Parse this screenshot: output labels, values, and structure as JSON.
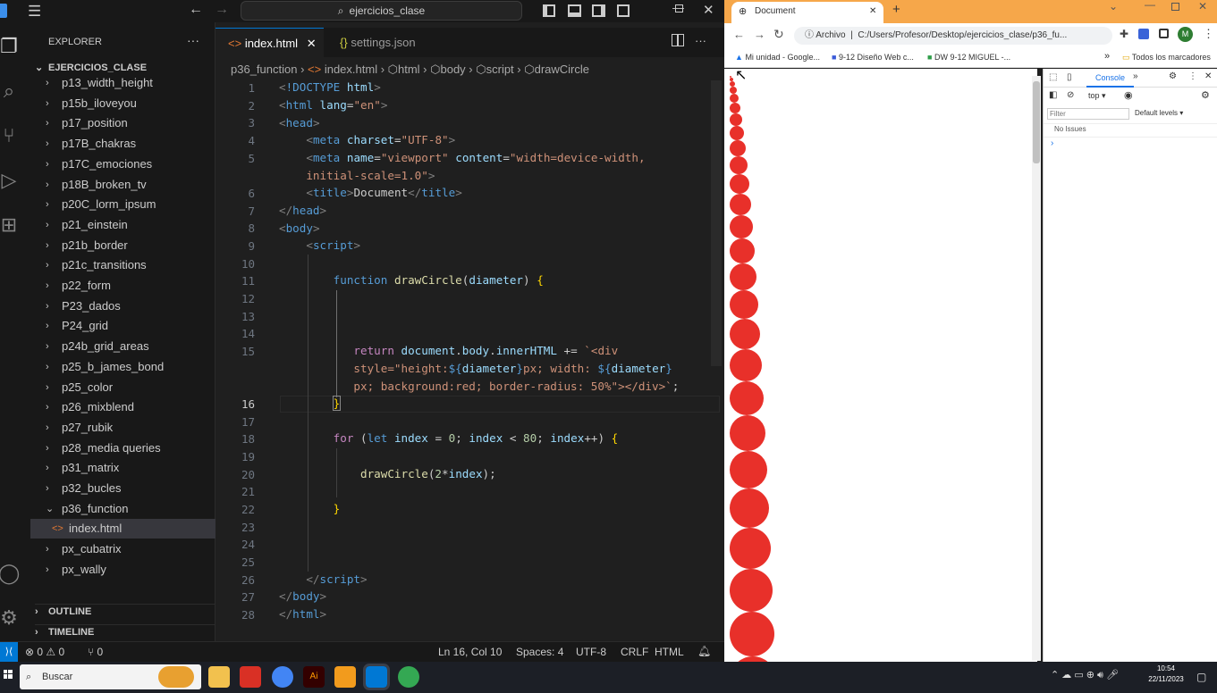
{
  "vscode": {
    "command_center": "ejercicios_clase",
    "explorer_title": "EXPLORER",
    "explorer_more": "···",
    "root_folder": "EJERCICIOS_CLASE",
    "items": [
      {
        "label": "p13_width_height",
        "type": "folder"
      },
      {
        "label": "p15b_iloveyou",
        "type": "folder"
      },
      {
        "label": "p17_position",
        "type": "folder"
      },
      {
        "label": "p17B_chakras",
        "type": "folder"
      },
      {
        "label": "p17C_emociones",
        "type": "folder"
      },
      {
        "label": "p18B_broken_tv",
        "type": "folder"
      },
      {
        "label": "p20C_lorm_ipsum",
        "type": "folder"
      },
      {
        "label": "p21_einstein",
        "type": "folder"
      },
      {
        "label": "p21b_border",
        "type": "folder"
      },
      {
        "label": "p21c_transitions",
        "type": "folder"
      },
      {
        "label": "p22_form",
        "type": "folder"
      },
      {
        "label": "P23_dados",
        "type": "folder"
      },
      {
        "label": "P24_grid",
        "type": "folder"
      },
      {
        "label": "p24b_grid_areas",
        "type": "folder"
      },
      {
        "label": "p25_b_james_bond",
        "type": "folder"
      },
      {
        "label": "p25_color",
        "type": "folder"
      },
      {
        "label": "p26_mixblend",
        "type": "folder"
      },
      {
        "label": "p27_rubik",
        "type": "folder"
      },
      {
        "label": "p28_media queries",
        "type": "folder"
      },
      {
        "label": "p31_matrix",
        "type": "folder"
      },
      {
        "label": "p32_bucles",
        "type": "folder"
      },
      {
        "label": "p36_function",
        "type": "open"
      },
      {
        "label": "index.html",
        "type": "file"
      },
      {
        "label": "px_cubatrix",
        "type": "folder"
      },
      {
        "label": "px_wally",
        "type": "folder"
      }
    ],
    "outline": "OUTLINE",
    "timeline": "TIMELINE",
    "tabs": [
      {
        "label": "index.html",
        "icon": "<>"
      },
      {
        "label": "settings.json",
        "icon": "{}"
      }
    ],
    "breadcrumb": [
      "p36_function",
      "index.html",
      "html",
      "body",
      "script",
      "drawCircle"
    ],
    "line_numbers": [
      "1",
      "2",
      "3",
      "4",
      "5",
      "",
      "6",
      "7",
      "8",
      "9",
      "10",
      "11",
      "12",
      "13",
      "14",
      "15",
      "",
      "",
      "16",
      "17",
      "18",
      "19",
      "20",
      "21",
      "22",
      "23",
      "24",
      "25",
      "26",
      "27",
      "28"
    ],
    "status": {
      "errors": "0",
      "warnings": "0",
      "ports": "0",
      "position": "Ln 16, Col 10",
      "spaces": "Spaces: 4",
      "encoding": "UTF-8",
      "eol": "CRLF",
      "lang": "HTML"
    }
  },
  "chrome": {
    "tab_title": "Document",
    "new_tab": "+",
    "url_label": "Archivo",
    "url": "C:/Users/Profesor/Desktop/ejercicios_clase/p36_fu...",
    "avatar": "M",
    "bookmarks": [
      "Mi unidad - Google...",
      "9-12 Diseño Web c...",
      "DW 9-12 MIGUEL -..."
    ],
    "bookmarks_more": "»",
    "all_bookmarks": "Todos los marcadores",
    "devtools": {
      "console_tab": "Console",
      "context": "top",
      "filter_placeholder": "Filter",
      "levels": "Default levels",
      "issues": "No Issues",
      "prompt": "›"
    },
    "circle_color": "#e8302a"
  },
  "taskbar": {
    "search": "Buscar",
    "time": "10:54",
    "date": "22/11/2023"
  }
}
